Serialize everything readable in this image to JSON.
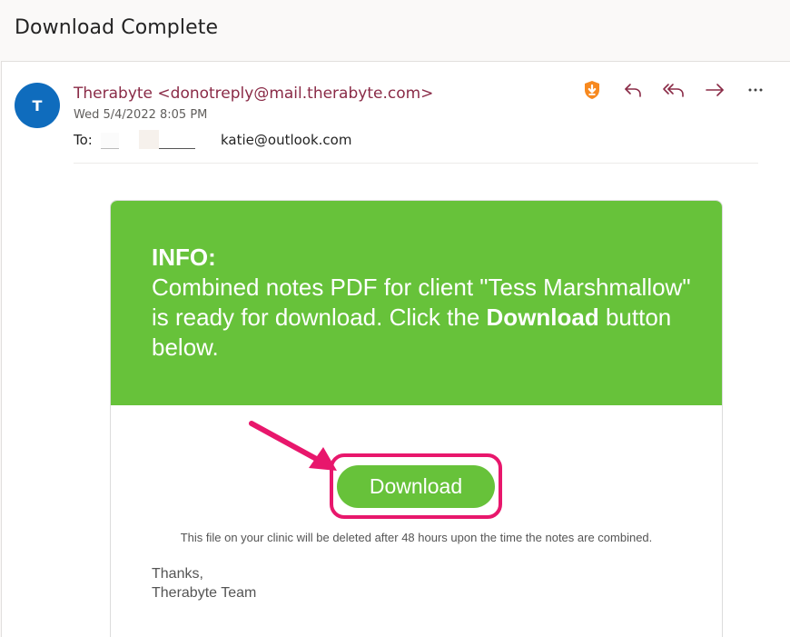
{
  "subject": "Download Complete",
  "sender": {
    "avatar_initial": "T",
    "display": "Therabyte <donotreply@mail.therabyte.com>",
    "date": "Wed 5/4/2022 8:05 PM",
    "to_label": "To:",
    "to_address": "katie@outlook.com"
  },
  "actions": [
    {
      "name": "shield-icon",
      "color": "#f7891f"
    },
    {
      "name": "reply-icon"
    },
    {
      "name": "reply-all-icon"
    },
    {
      "name": "forward-icon"
    },
    {
      "name": "more-icon"
    }
  ],
  "email_body": {
    "info_heading": "INFO:",
    "info_message": "Combined notes PDF for client \"Tess Marshmallow\" is ready for download. Click the",
    "info_bold": "Download",
    "info_tail": " button below.",
    "download_label": "Download",
    "note": "This file on your clinic will be deleted after 48 hours upon the time the notes are combined.",
    "signoff": "Thanks,",
    "signature": "Therabyte Team"
  },
  "colors": {
    "accent_green": "#67c23a",
    "sender_color": "#8a2b47",
    "highlight": "#e8176c",
    "avatar": "#0f6cbd",
    "icon_color": "#8a2b47"
  }
}
